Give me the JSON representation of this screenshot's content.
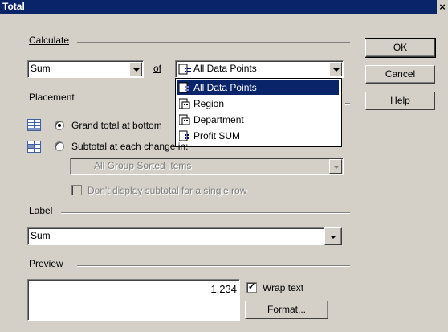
{
  "window": {
    "title": "Total",
    "close_glyph": "×"
  },
  "calculate": {
    "label": "Calculate",
    "function_value": "Sum",
    "of_label": "of",
    "target_value": "All Data Points",
    "dropdown_items": [
      {
        "label": "All Data Points",
        "icon": "data-points-icon"
      },
      {
        "label": "Region",
        "icon": "group-icon"
      },
      {
        "label": "Department",
        "icon": "group-icon"
      },
      {
        "label": "Profit SUM",
        "icon": "data-points-icon"
      }
    ]
  },
  "placement": {
    "label": "Placement",
    "grand_total_label": "Grand total at bottom",
    "subtotal_label": "Subtotal at each change in:",
    "subtotal_field_value": "All Group Sorted Items",
    "dont_display_label": "Don't display subtotal for a single row",
    "selected": "grand_total"
  },
  "label_section": {
    "label": "Label",
    "value": "Sum"
  },
  "preview": {
    "label": "Preview",
    "value": "1,234",
    "wrap_label": "Wrap text",
    "wrap_checked": true,
    "format_button": "Format..."
  },
  "buttons": {
    "ok": "OK",
    "cancel": "Cancel",
    "help": "Help"
  },
  "colors": {
    "titlebar": "#0a246a",
    "dialog": "#d4d0c8",
    "selection": "#0a246a"
  }
}
